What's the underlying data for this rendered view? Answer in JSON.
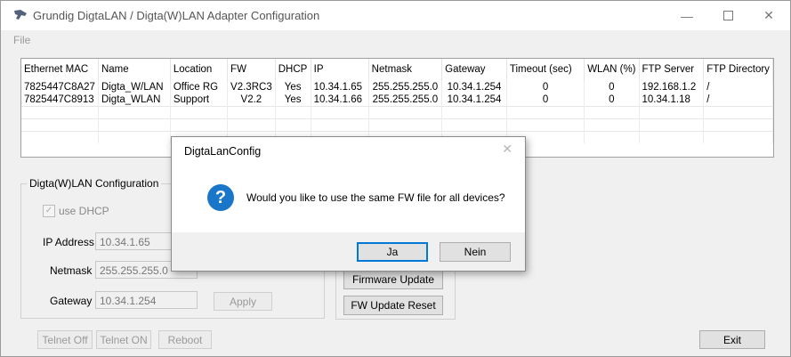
{
  "window": {
    "title": "Grundig DigtaLAN / Digta(W)LAN Adapter  Configuration",
    "minimize_icon": "minimize-icon",
    "maximize_icon": "maximize-icon",
    "close_icon": "close-icon"
  },
  "menu": {
    "file": "File"
  },
  "grid": {
    "headers": [
      "Ethernet MAC",
      "Name",
      "Location",
      "FW",
      "DHCP",
      "IP",
      "Netmask",
      "Gateway",
      "Timeout (sec)",
      "WLAN (%)",
      "FTP Server",
      "FTP Directory"
    ],
    "rows": [
      [
        "7825447C8A27",
        "Digta_W/LAN",
        "Office RG",
        "V2.3RC3",
        "Yes",
        "10.34.1.65",
        "255.255.255.0",
        "10.34.1.254",
        "0",
        "0",
        "192.168.1.2",
        "/"
      ],
      [
        "7825447C8913",
        "Digta_WLAN",
        "Support",
        "V2.2",
        "Yes",
        "10.34.1.66",
        "255.255.255.0",
        "10.34.1.254",
        "0",
        "0",
        "10.34.1.18",
        "/"
      ]
    ]
  },
  "config": {
    "group_label": "Digta(W)LAN Configuration",
    "use_dhcp_label": "use DHCP",
    "use_dhcp_checked": true,
    "ip_label": "IP Address",
    "ip_value": "10.34.1.65",
    "netmask_label": "Netmask",
    "netmask_value": "255.255.255.0",
    "gateway_label": "Gateway",
    "gateway_value": "10.34.1.254",
    "apply_label": "Apply"
  },
  "fw": {
    "firmware_update_label": "Firmware Update",
    "fw_update_reset_label": "FW Update  Reset"
  },
  "bottom": {
    "telnet_off_label": "Telnet Off",
    "telnet_on_label": "Telnet ON",
    "reboot_label": "Reboot",
    "exit_label": "Exit"
  },
  "dialog": {
    "title": "DigtaLanConfig",
    "message": "Would you like to use the same FW file for all devices?",
    "icon": "question-icon",
    "yes_label": "Ja",
    "no_label": "Nein"
  },
  "colors": {
    "accent": "#0078d7",
    "question_icon": "#1a76c8"
  }
}
